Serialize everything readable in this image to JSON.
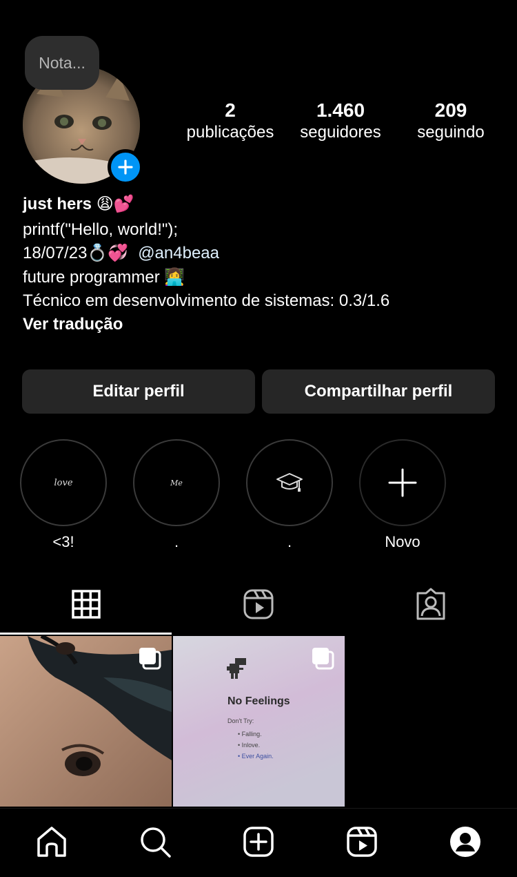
{
  "note": {
    "placeholder": "Nota..."
  },
  "stats": [
    {
      "value": "2",
      "label": "publicações"
    },
    {
      "value": "1.460",
      "label": "seguidores"
    },
    {
      "value": "209",
      "label": "seguindo"
    }
  ],
  "bio": {
    "name": "just hers 😩💕",
    "line1": "printf(\"Hello, world!\");",
    "line2_date": "18/07/23💍💞",
    "line2_mention": "@an4beaa",
    "line3": "future programmer 👩‍💻",
    "line4": "Técnico em desenvolvimento de sistemas: 0.3/1.6",
    "translate": "Ver tradução"
  },
  "buttons": {
    "edit": "Editar perfil",
    "share": "Compartilhar perfil"
  },
  "highlights": [
    {
      "label": "<3!",
      "cover_text": "love"
    },
    {
      "label": ".",
      "cover_text": "Me"
    },
    {
      "label": ".",
      "cover_icon": "graduation-cap-icon"
    },
    {
      "label": "Novo",
      "cover_icon": "plus-icon"
    }
  ],
  "tabs": [
    "grid-icon",
    "reels-icon",
    "tagged-icon"
  ],
  "posts": [
    {
      "type": "carousel",
      "alt_icon": "carousel-icon"
    },
    {
      "type": "carousel",
      "title": "No Feelings",
      "subtitle": "Don't Try:",
      "items": [
        "Falling.",
        "Inlove.",
        "Ever Again."
      ]
    }
  ],
  "nav": [
    "home-icon",
    "search-icon",
    "create-icon",
    "reels-icon",
    "profile-icon"
  ],
  "colors": {
    "accent": "#0095f6",
    "button_bg": "#262626",
    "background": "#000000"
  }
}
